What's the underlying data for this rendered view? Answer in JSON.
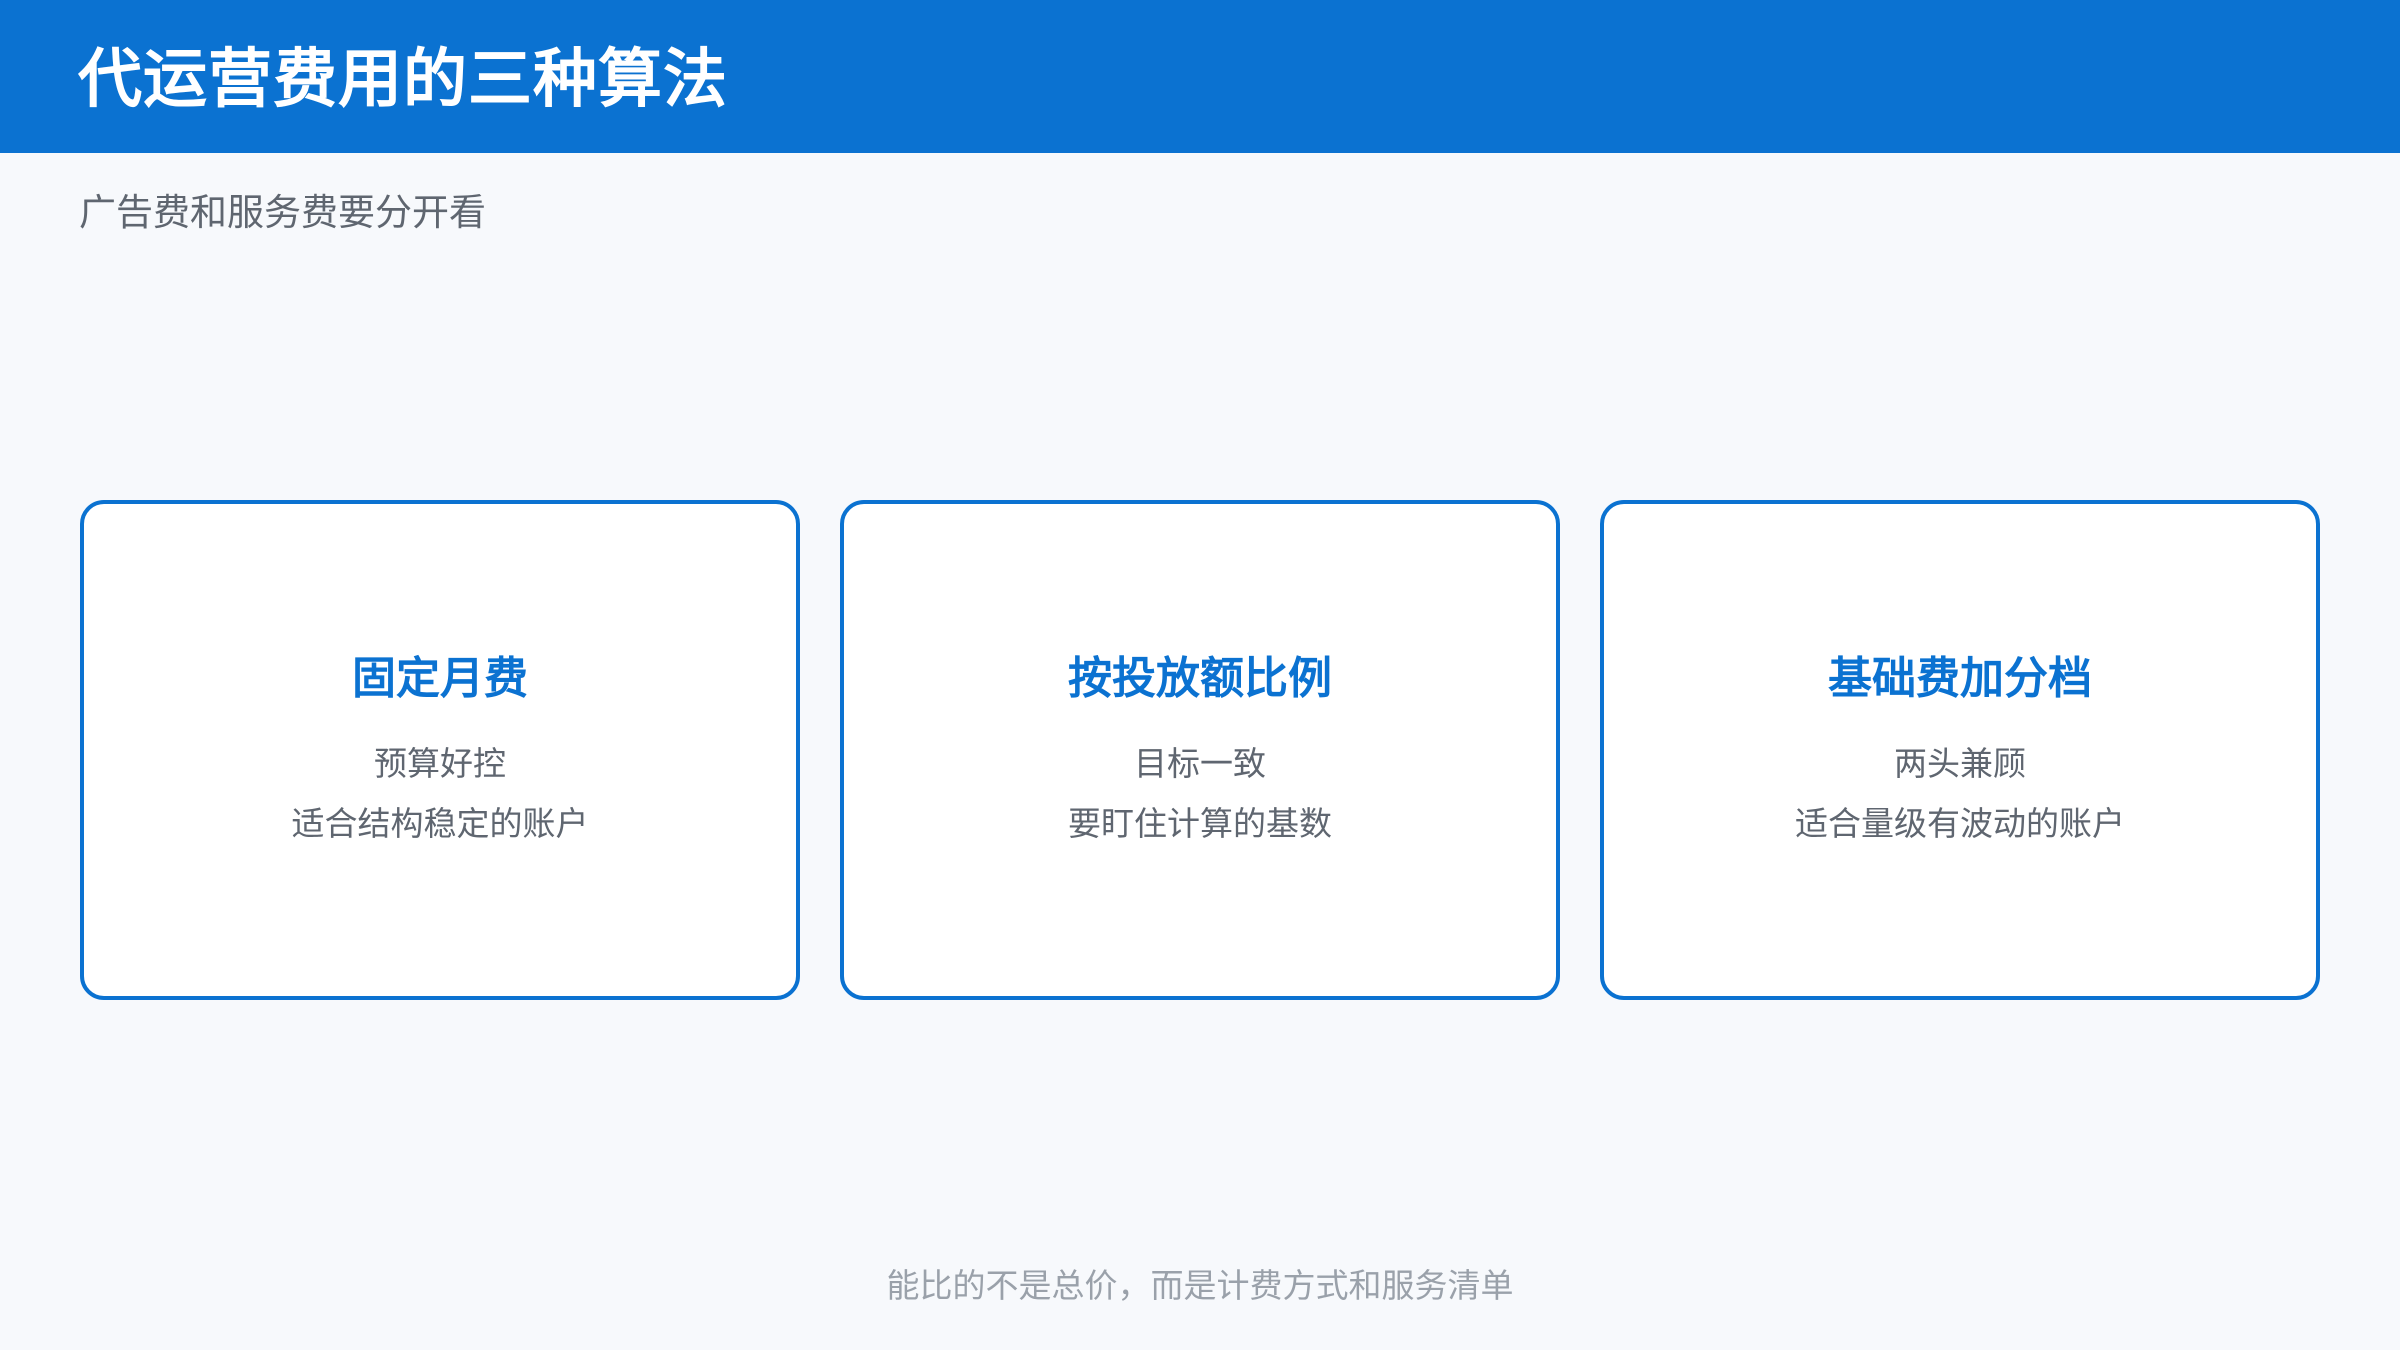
{
  "header": {
    "title": "代运营费用的三种算法",
    "subtitle": "广告费和服务费要分开看"
  },
  "cards": [
    {
      "title": "固定月费",
      "line1": "预算好控",
      "line2": "适合结构稳定的账户"
    },
    {
      "title": "按投放额比例",
      "line1": "目标一致",
      "line2": "要盯住计算的基数"
    },
    {
      "title": "基础费加分档",
      "line1": "两头兼顾",
      "line2": "适合量级有波动的账户"
    }
  ],
  "footer": {
    "note": "能比的不是总价，而是计费方式和服务清单"
  },
  "colors": {
    "brand": "#0b72d1",
    "background": "#f7f9fc",
    "body_text": "#5f6670",
    "muted_text": "#9aa1aa"
  }
}
